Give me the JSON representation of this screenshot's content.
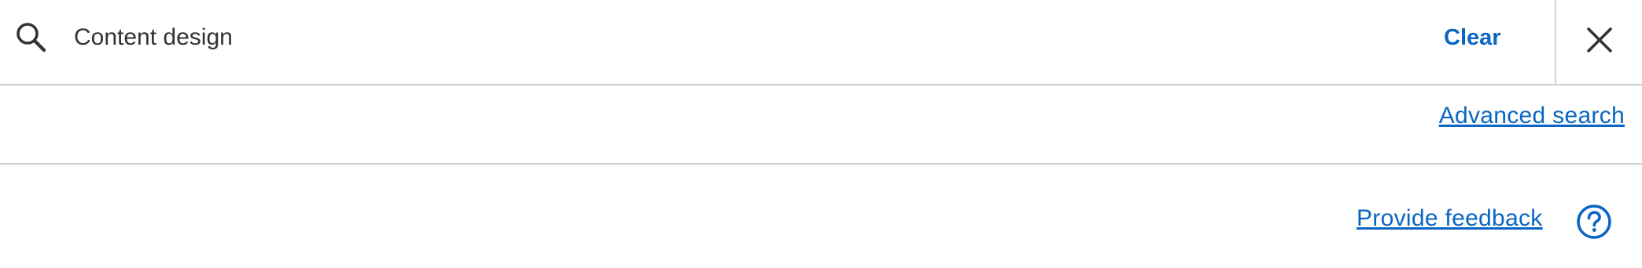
{
  "search": {
    "value": "Content design",
    "clear_label": "Clear",
    "search_icon": "search-icon",
    "close_icon": "close-icon"
  },
  "links": {
    "advanced_search": "Advanced search",
    "provide_feedback": "Provide feedback",
    "help_icon": "help-circle-icon"
  },
  "colors": {
    "accent": "#0a66c2",
    "text": "#333333",
    "divider": "#cccccc"
  }
}
